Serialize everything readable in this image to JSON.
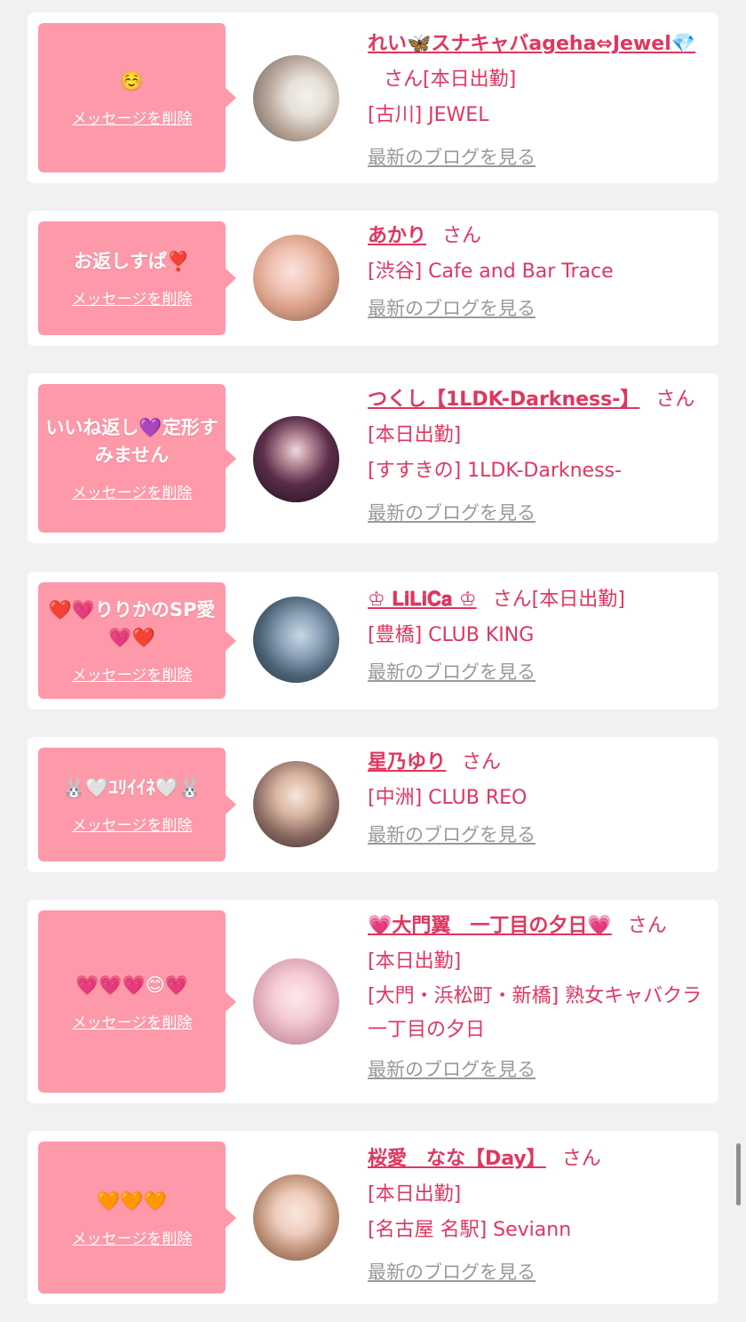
{
  "delete_label": "メッセージを削除",
  "blog_label": "最新のブログを見る",
  "san_label": "さん",
  "entries": [
    {
      "message": "☺️",
      "name": "れい🦋スナキャバageha⇔Jewel💎",
      "san_suffix": "[本日出勤]",
      "shop": "[古川] JEWEL",
      "avatar_icon": "profile-photo"
    },
    {
      "message": "お返しすぱ❣️",
      "name": "あかり",
      "san_suffix": "",
      "shop": "[渋谷] Cafe and Bar Trace",
      "avatar_icon": "profile-photo"
    },
    {
      "message": "いいね返し💜定形すみません",
      "name": "つくし【1LDK-Darkness-】",
      "san_suffix": "[本日出勤]",
      "shop": "[すすきの] 1LDK-Darkness-",
      "avatar_icon": "profile-photo"
    },
    {
      "message": "❤️💗りりかのSP愛💗❤️",
      "name": "♔ 𝐋𝐢𝐋𝐢𝐂𝐚 ♔",
      "san_suffix": "[本日出勤]",
      "shop": "[豊橋] CLUB KING",
      "avatar_icon": "profile-photo"
    },
    {
      "message": "🐰🤍ﾕﾘｲｲﾈ🤍🐰",
      "name": "星乃ゆり",
      "san_suffix": "",
      "shop": "[中洲] CLUB REO",
      "avatar_icon": "profile-photo"
    },
    {
      "message": "💗💗💗😊💗",
      "name": "💗大門翼　一丁目の夕日💗",
      "san_suffix": "[本日出勤]",
      "shop": "[大門・浜松町・新橋] 熟女キャバクラ 一丁目の夕日",
      "avatar_icon": "profile-photo"
    },
    {
      "message": "🧡🧡🧡",
      "name": "桜愛　なな【Day】",
      "san_suffix": "[本日出勤]",
      "shop": "[名古屋 名駅] Seviann",
      "avatar_icon": "profile-photo"
    }
  ],
  "colors": {
    "page_bg": "#f1f1f3",
    "bubble": "#fd99a9",
    "accent": "#e0365f",
    "blog_link": "#999999"
  }
}
